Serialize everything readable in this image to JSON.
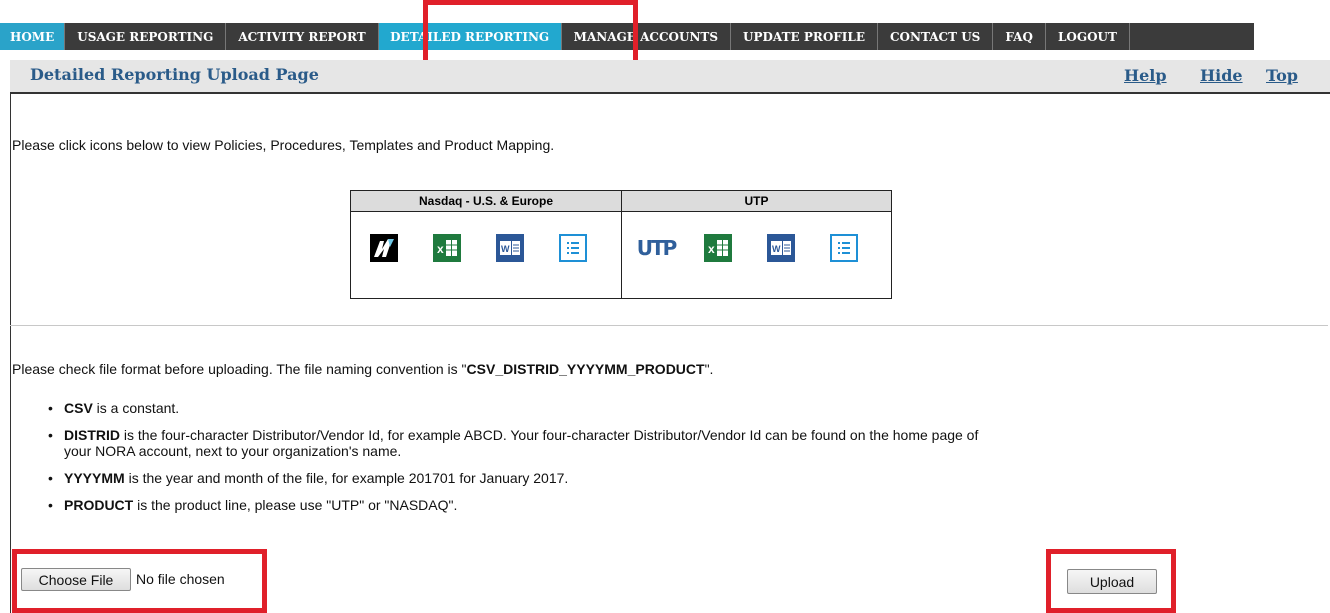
{
  "nav": {
    "items": [
      "HOME",
      "USAGE REPORTING",
      "ACTIVITY REPORT",
      "DETAILED REPORTING",
      "MANAGE ACCOUNTS",
      "UPDATE PROFILE",
      "CONTACT US",
      "FAQ",
      "LOGOUT"
    ],
    "active": "DETAILED REPORTING"
  },
  "subbar": {
    "title": "Detailed Reporting Upload Page",
    "help": "Help",
    "hide": "Hide",
    "top": "Top"
  },
  "intro_text": "Please click icons below to view Policies, Procedures, Templates and Product Mapping.",
  "icon_table": {
    "nasdaq_header": "Nasdaq - U.S. & Europe",
    "utp_header": "UTP",
    "nasdaq_icons": [
      "nasdaq-logo-icon",
      "excel-icon",
      "word-icon",
      "document-list-icon"
    ],
    "utp_icons": [
      "utp-logo-icon",
      "excel-icon",
      "word-icon",
      "document-list-icon"
    ],
    "utp_logo_text": "UTP"
  },
  "format": {
    "prefix": "Please check file format before uploading. The file naming convention is \"",
    "convention": "CSV_DISTRID_YYYYMM_PRODUCT",
    "suffix": "\"."
  },
  "bullets": [
    {
      "term": "CSV",
      "text": " is a constant."
    },
    {
      "term": "DISTRID",
      "text": " is the four-character Distributor/Vendor Id, for example ABCD. Your four-character Distributor/Vendor Id can be found on the home page of",
      "text2": "your NORA account, next to your organization's name."
    },
    {
      "term": "YYYYMM",
      "text": " is the year and month of the file, for example 201701 for January 2017."
    },
    {
      "term": "PRODUCT",
      "text": " is the product line, please use \"UTP\" or \"NASDAQ\"."
    }
  ],
  "upload": {
    "choose_label": "Choose File",
    "no_file": "No file chosen",
    "upload_label": "Upload"
  },
  "colors": {
    "nav_bg": "#3b3b3b",
    "nav_active": "#22a8cf",
    "title_blue": "#2a5b89",
    "highlight_red": "#e0202a"
  }
}
